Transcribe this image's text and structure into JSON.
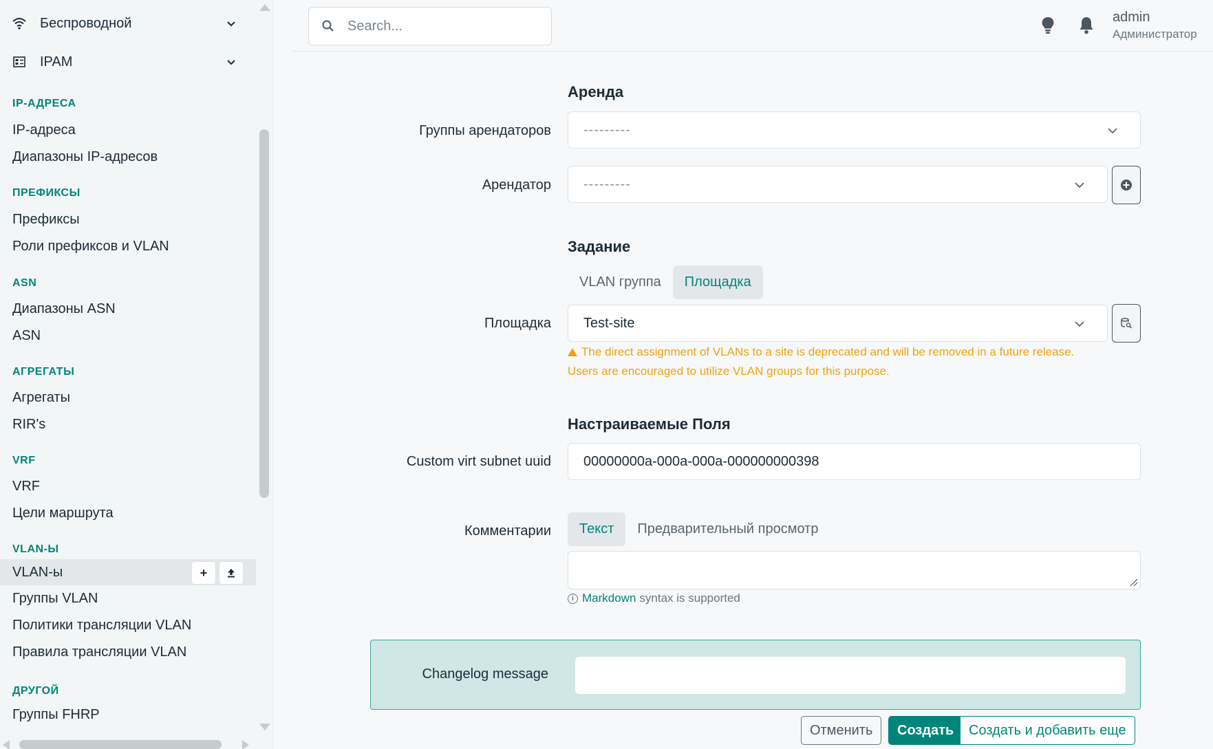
{
  "sidebar": {
    "groups": [
      {
        "label": "Беспроводной",
        "icon": "wifi-icon"
      },
      {
        "label": "IPAM",
        "icon": "ipam-icon"
      }
    ],
    "sections": [
      {
        "title": "IP-АДРЕСА",
        "items": [
          "IP-адреса",
          "Диапазоны IP-адресов"
        ]
      },
      {
        "title": "ПРЕФИКСЫ",
        "items": [
          "Префиксы",
          "Роли префиксов и VLAN"
        ]
      },
      {
        "title": "ASN",
        "items": [
          "Диапазоны ASN",
          "ASN"
        ]
      },
      {
        "title": "АГРЕГАТЫ",
        "items": [
          "Агрегаты",
          "RIR's"
        ]
      },
      {
        "title": "VRF",
        "items": [
          "VRF",
          "Цели маршрута"
        ]
      },
      {
        "title": "VLAN-Ы",
        "items": [
          "VLAN-ы",
          "Группы VLAN",
          "Политики трансляции VLAN",
          "Правила трансляции VLAN"
        ]
      },
      {
        "title": "ДРУГОЙ",
        "items": [
          "Группы FHRP"
        ]
      }
    ],
    "active_item": "VLAN-ы",
    "active_item_buttons": {
      "add": "+",
      "import": "upload-icon"
    }
  },
  "topbar": {
    "search_placeholder": "Search...",
    "user": {
      "name": "admin",
      "role": "Администратор"
    }
  },
  "form": {
    "tenancy": {
      "heading": "Аренда",
      "tenant_group_label": "Группы арендаторов",
      "tenant_group_value": "---------",
      "tenant_label": "Арендатор",
      "tenant_value": "---------"
    },
    "assignment": {
      "heading": "Задание",
      "tabs": [
        "VLAN группа",
        "Площадка"
      ],
      "active_tab": "Площадка",
      "site_label": "Площадка",
      "site_value": "Test-site",
      "warning_line1": "The direct assignment of VLANs to a site is deprecated and will be removed in a future release.",
      "warning_line2": "Users are encouraged to utilize VLAN groups for this purpose."
    },
    "custom_fields": {
      "heading": "Настраиваемые Поля",
      "uuid_label": "Custom virt subnet uuid",
      "uuid_value": "00000000a-000a-000a-000000000398"
    },
    "comments": {
      "label": "Комментарии",
      "tabs": [
        "Текст",
        "Предварительный просмотр"
      ],
      "active_tab": "Текст",
      "hint_link": "Markdown",
      "hint_text": "syntax is supported"
    },
    "changelog": {
      "label": "Changelog message",
      "value": ""
    },
    "buttons": {
      "cancel": "Отменить",
      "create": "Создать",
      "create_more": "Создать и добавить еще"
    }
  },
  "colors": {
    "accent": "#00857a",
    "warning": "#f0a30a",
    "changelog_bg": "#cfe7e5"
  }
}
